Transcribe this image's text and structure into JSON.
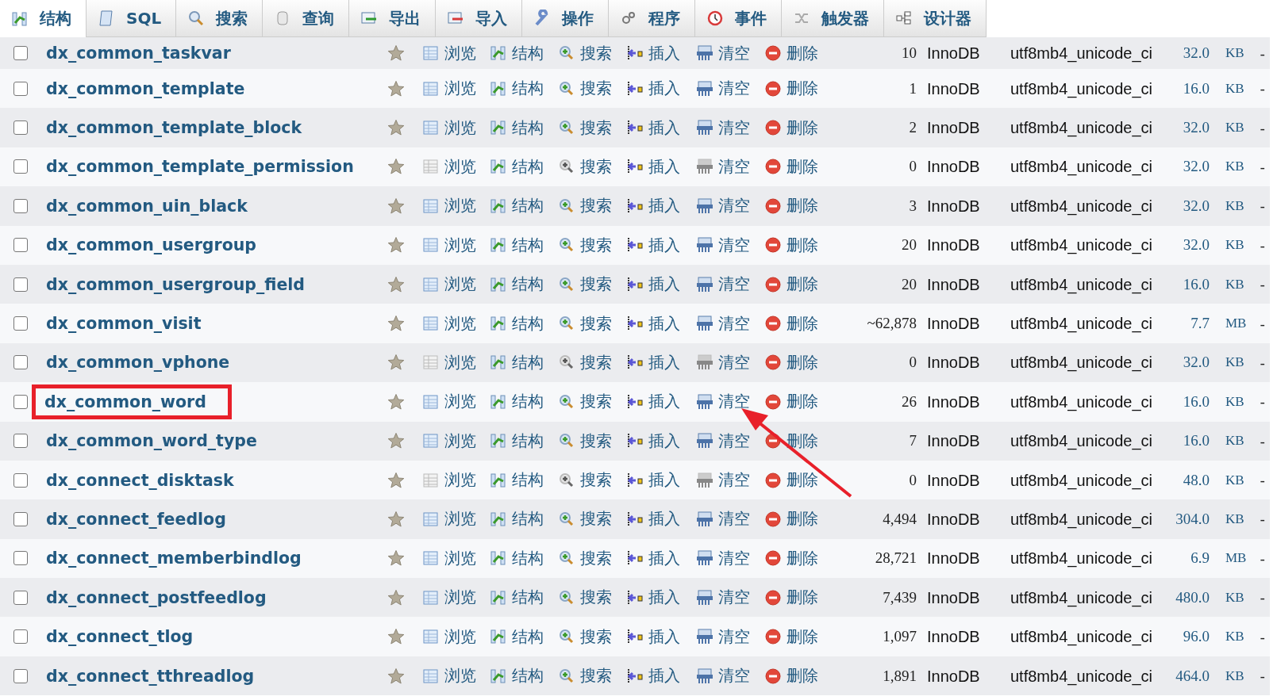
{
  "tabs": [
    {
      "kind": "structure",
      "label": "结构",
      "selected": true
    },
    {
      "kind": "sql",
      "label": "SQL",
      "selected": false
    },
    {
      "kind": "search",
      "label": "搜索",
      "selected": false
    },
    {
      "kind": "query",
      "label": "查询",
      "selected": false
    },
    {
      "kind": "export",
      "label": "导出",
      "selected": false
    },
    {
      "kind": "import",
      "label": "导入",
      "selected": false
    },
    {
      "kind": "operations",
      "label": "操作",
      "selected": false
    },
    {
      "kind": "routines",
      "label": "程序",
      "selected": false
    },
    {
      "kind": "events",
      "label": "事件",
      "selected": false
    },
    {
      "kind": "triggers",
      "label": "触发器",
      "selected": false
    },
    {
      "kind": "designer",
      "label": "设计器",
      "selected": false
    }
  ],
  "rows": [
    {
      "name": "dx_common_taskvar",
      "checked": false,
      "empty": false,
      "highlighted": false,
      "actions": [
        "浏览",
        "结构",
        "搜索",
        "插入",
        "清空",
        "删除"
      ],
      "rows": "10",
      "engine": "InnoDB",
      "collation": "utf8mb4_unicode_ci",
      "size": "32.0",
      "unit": "KB",
      "overhead": "-"
    },
    {
      "name": "dx_common_template",
      "checked": false,
      "empty": false,
      "highlighted": false,
      "actions": [
        "浏览",
        "结构",
        "搜索",
        "插入",
        "清空",
        "删除"
      ],
      "rows": "1",
      "engine": "InnoDB",
      "collation": "utf8mb4_unicode_ci",
      "size": "16.0",
      "unit": "KB",
      "overhead": "-"
    },
    {
      "name": "dx_common_template_block",
      "checked": false,
      "empty": false,
      "highlighted": false,
      "actions": [
        "浏览",
        "结构",
        "搜索",
        "插入",
        "清空",
        "删除"
      ],
      "rows": "2",
      "engine": "InnoDB",
      "collation": "utf8mb4_unicode_ci",
      "size": "32.0",
      "unit": "KB",
      "overhead": "-"
    },
    {
      "name": "dx_common_template_permission",
      "checked": false,
      "empty": true,
      "highlighted": false,
      "actions": [
        "浏览",
        "结构",
        "搜索",
        "插入",
        "清空",
        "删除"
      ],
      "rows": "0",
      "engine": "InnoDB",
      "collation": "utf8mb4_unicode_ci",
      "size": "32.0",
      "unit": "KB",
      "overhead": "-"
    },
    {
      "name": "dx_common_uin_black",
      "checked": false,
      "empty": false,
      "highlighted": false,
      "actions": [
        "浏览",
        "结构",
        "搜索",
        "插入",
        "清空",
        "删除"
      ],
      "rows": "3",
      "engine": "InnoDB",
      "collation": "utf8mb4_unicode_ci",
      "size": "32.0",
      "unit": "KB",
      "overhead": "-"
    },
    {
      "name": "dx_common_usergroup",
      "checked": false,
      "empty": false,
      "highlighted": false,
      "actions": [
        "浏览",
        "结构",
        "搜索",
        "插入",
        "清空",
        "删除"
      ],
      "rows": "20",
      "engine": "InnoDB",
      "collation": "utf8mb4_unicode_ci",
      "size": "32.0",
      "unit": "KB",
      "overhead": "-"
    },
    {
      "name": "dx_common_usergroup_field",
      "checked": false,
      "empty": false,
      "highlighted": false,
      "actions": [
        "浏览",
        "结构",
        "搜索",
        "插入",
        "清空",
        "删除"
      ],
      "rows": "20",
      "engine": "InnoDB",
      "collation": "utf8mb4_unicode_ci",
      "size": "16.0",
      "unit": "KB",
      "overhead": "-"
    },
    {
      "name": "dx_common_visit",
      "checked": false,
      "empty": false,
      "highlighted": false,
      "actions": [
        "浏览",
        "结构",
        "搜索",
        "插入",
        "清空",
        "删除"
      ],
      "rows": "~62,878",
      "engine": "InnoDB",
      "collation": "utf8mb4_unicode_ci",
      "size": "7.7",
      "unit": "MB",
      "overhead": "-"
    },
    {
      "name": "dx_common_vphone",
      "checked": false,
      "empty": true,
      "highlighted": false,
      "actions": [
        "浏览",
        "结构",
        "搜索",
        "插入",
        "清空",
        "删除"
      ],
      "rows": "0",
      "engine": "InnoDB",
      "collation": "utf8mb4_unicode_ci",
      "size": "32.0",
      "unit": "KB",
      "overhead": "-"
    },
    {
      "name": "dx_common_word",
      "checked": false,
      "empty": false,
      "highlighted": true,
      "actions": [
        "浏览",
        "结构",
        "搜索",
        "插入",
        "清空",
        "删除"
      ],
      "rows": "26",
      "engine": "InnoDB",
      "collation": "utf8mb4_unicode_ci",
      "size": "16.0",
      "unit": "KB",
      "overhead": "-"
    },
    {
      "name": "dx_common_word_type",
      "checked": false,
      "empty": false,
      "highlighted": false,
      "actions": [
        "浏览",
        "结构",
        "搜索",
        "插入",
        "清空",
        "删除"
      ],
      "rows": "7",
      "engine": "InnoDB",
      "collation": "utf8mb4_unicode_ci",
      "size": "16.0",
      "unit": "KB",
      "overhead": "-"
    },
    {
      "name": "dx_connect_disktask",
      "checked": false,
      "empty": true,
      "highlighted": false,
      "actions": [
        "浏览",
        "结构",
        "搜索",
        "插入",
        "清空",
        "删除"
      ],
      "rows": "0",
      "engine": "InnoDB",
      "collation": "utf8mb4_unicode_ci",
      "size": "48.0",
      "unit": "KB",
      "overhead": "-"
    },
    {
      "name": "dx_connect_feedlog",
      "checked": false,
      "empty": false,
      "highlighted": false,
      "actions": [
        "浏览",
        "结构",
        "搜索",
        "插入",
        "清空",
        "删除"
      ],
      "rows": "4,494",
      "engine": "InnoDB",
      "collation": "utf8mb4_unicode_ci",
      "size": "304.0",
      "unit": "KB",
      "overhead": "-"
    },
    {
      "name": "dx_connect_memberbindlog",
      "checked": false,
      "empty": false,
      "highlighted": false,
      "actions": [
        "浏览",
        "结构",
        "搜索",
        "插入",
        "清空",
        "删除"
      ],
      "rows": "28,721",
      "engine": "InnoDB",
      "collation": "utf8mb4_unicode_ci",
      "size": "6.9",
      "unit": "MB",
      "overhead": "-"
    },
    {
      "name": "dx_connect_postfeedlog",
      "checked": false,
      "empty": false,
      "highlighted": false,
      "actions": [
        "浏览",
        "结构",
        "搜索",
        "插入",
        "清空",
        "删除"
      ],
      "rows": "7,439",
      "engine": "InnoDB",
      "collation": "utf8mb4_unicode_ci",
      "size": "480.0",
      "unit": "KB",
      "overhead": "-"
    },
    {
      "name": "dx_connect_tlog",
      "checked": false,
      "empty": false,
      "highlighted": false,
      "actions": [
        "浏览",
        "结构",
        "搜索",
        "插入",
        "清空",
        "删除"
      ],
      "rows": "1,097",
      "engine": "InnoDB",
      "collation": "utf8mb4_unicode_ci",
      "size": "96.0",
      "unit": "KB",
      "overhead": "-"
    },
    {
      "name": "dx_connect_tthreadlog",
      "checked": false,
      "empty": false,
      "highlighted": false,
      "actions": [
        "浏览",
        "结构",
        "搜索",
        "插入",
        "清空",
        "删除"
      ],
      "rows": "1,891",
      "engine": "InnoDB",
      "collation": "utf8mb4_unicode_ci",
      "size": "464.0",
      "unit": "KB",
      "overhead": "-"
    }
  ],
  "annotation": {
    "kind": "arrow"
  }
}
